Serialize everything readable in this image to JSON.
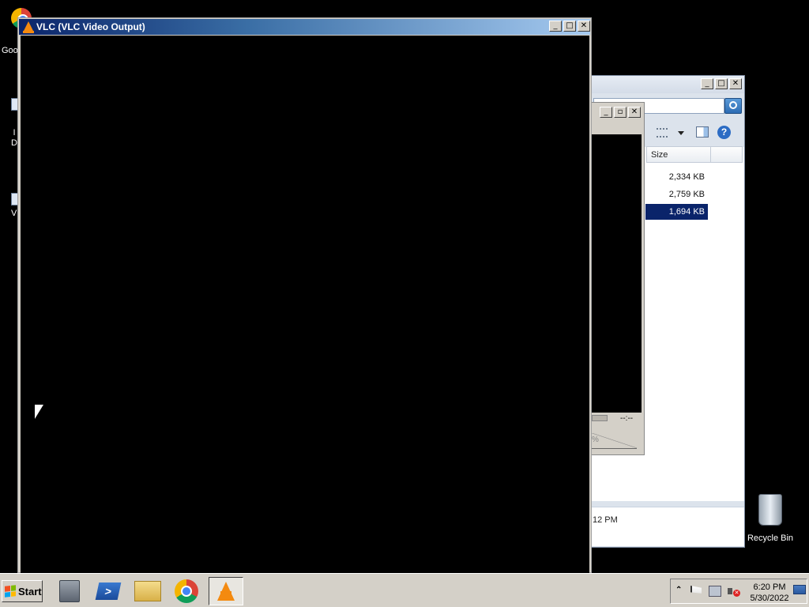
{
  "desktop": {
    "left_icons": [
      {
        "label": "Goo",
        "icon": "chrome-icon"
      },
      {
        "label": "I\nD",
        "icon": "document-icon"
      },
      {
        "label": "VL",
        "icon": "document-icon"
      }
    ],
    "recycle_bin_label": "Recycle Bin"
  },
  "vlc_window": {
    "title": "VLC (VLC Video Output)",
    "buttons": {
      "minimize": "_",
      "maximize": "□",
      "close": "✕"
    }
  },
  "explorer_window": {
    "column_header": "Size",
    "rows": [
      {
        "size": "2,334 KB",
        "selected": false
      },
      {
        "size": "2,759 KB",
        "selected": false
      },
      {
        "size": "1,694 KB",
        "selected": true
      }
    ],
    "details_text": "12 PM"
  },
  "inner_window": {
    "time_text": "--:--",
    "percent_text": "%"
  },
  "taskbar": {
    "start_label": "Start",
    "items": [
      {
        "name": "server-manager-icon"
      },
      {
        "name": "powershell-icon"
      },
      {
        "name": "file-explorer-icon"
      },
      {
        "name": "chrome-icon"
      },
      {
        "name": "vlc-icon",
        "active": true
      }
    ],
    "clock_time": "6:20 PM",
    "clock_date": "5/30/2022"
  },
  "colors": {
    "selection": "#0a246a",
    "vlc_orange": "#f48a0f",
    "title_active": "#0a246a"
  }
}
